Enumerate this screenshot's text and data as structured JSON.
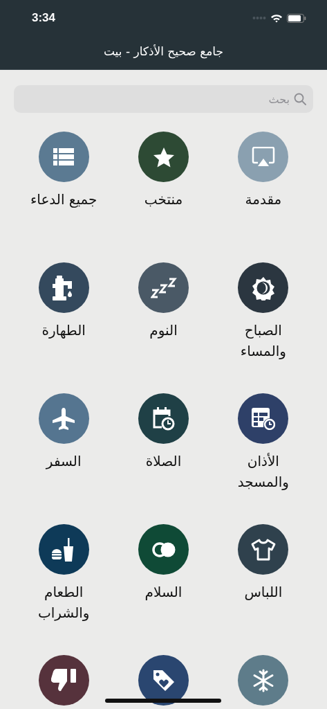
{
  "status_bar": {
    "time": "3:34"
  },
  "nav": {
    "title": "جامع صحيح الأذكار - بيت"
  },
  "search": {
    "placeholder": "بحث"
  },
  "items": [
    {
      "label": "مقدمة",
      "color": "#8aa0b0"
    },
    {
      "label": "منتخب",
      "color": "#2d4a34"
    },
    {
      "label": "جميع الدعاء",
      "color": "#5b7a92"
    },
    {
      "label": "الصباح والمساء",
      "color": "#2b3640"
    },
    {
      "label": "النوم",
      "color": "#4a5966"
    },
    {
      "label": "الطهارة",
      "color": "#34495d"
    },
    {
      "label": "الأذان والمسجد",
      "color": "#2e4068"
    },
    {
      "label": "الصلاة",
      "color": "#1f4046"
    },
    {
      "label": "السفر",
      "color": "#557590"
    },
    {
      "label": "اللباس",
      "color": "#2f414d"
    },
    {
      "label": "السلام",
      "color": "#0f4a36"
    },
    {
      "label": "الطعام والشراب",
      "color": "#0e3a58"
    },
    {
      "color": "#5e7c8a"
    },
    {
      "color": "#2a4670"
    },
    {
      "color": "#56323c"
    }
  ]
}
